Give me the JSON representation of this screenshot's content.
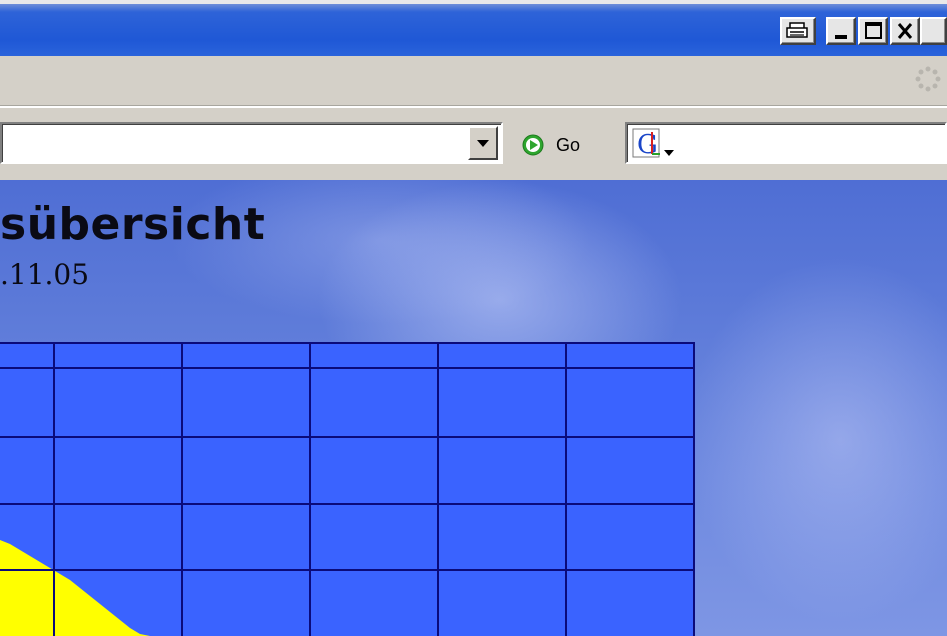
{
  "window": {
    "buttons": {
      "print_icon": "printer-icon",
      "minimize_icon": "minimize-icon",
      "maximize_icon": "maximize-icon",
      "close_icon": "close-icon"
    }
  },
  "address_bar": {
    "url_value": "",
    "go_label": "Go",
    "search_engine_icon": "google-g-icon"
  },
  "page": {
    "title": "sübersicht",
    "date": ".11.05"
  },
  "colors": {
    "grid_fill": "#3a63ff",
    "grid_lines": "#0b0b7a",
    "yellow_shape": "#ffff00"
  }
}
